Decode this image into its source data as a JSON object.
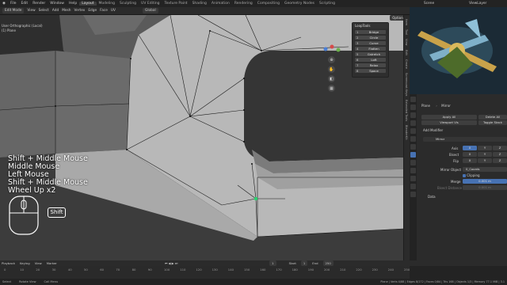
{
  "top_menu": {
    "items": [
      "File",
      "Edit",
      "Render",
      "Window",
      "Help"
    ],
    "workspaces": [
      "Layout",
      "Modeling",
      "Sculpting",
      "UV Editing",
      "Texture Paint",
      "Shading",
      "Animation",
      "Rendering",
      "Compositing",
      "Geometry Nodes",
      "Scripting"
    ],
    "active_workspace": "Layout",
    "scene": "Scene",
    "view_layer": "ViewLayer"
  },
  "viewport_header": {
    "mode": "Edit Mode",
    "menus": [
      "View",
      "Select",
      "Add",
      "Mesh",
      "Vertex",
      "Edge",
      "Face",
      "UV"
    ],
    "orientation": "Global",
    "options_label": "Options"
  },
  "viewport": {
    "view_label": "User Orthographic (Local)",
    "object_label": "(1) Plane"
  },
  "looptools": {
    "title": "LoopTools",
    "items": [
      {
        "n": "1",
        "label": "Bridge"
      },
      {
        "n": "2",
        "label": "Circle"
      },
      {
        "n": "3",
        "label": "Curve"
      },
      {
        "n": "4",
        "label": "Flatten"
      },
      {
        "n": "5",
        "label": "Gstretch"
      },
      {
        "n": "6",
        "label": "Loft"
      },
      {
        "n": "7",
        "label": "Relax"
      },
      {
        "n": "8",
        "label": "Space"
      }
    ]
  },
  "key_overlay": {
    "lines": [
      "Shift + Middle Mouse",
      "Middle Mouse",
      "Left Mouse",
      "Shift + Middle Mouse",
      "Wheel Up x2"
    ],
    "modifier_key": "Shift"
  },
  "right_strip_tabs": [
    "Item",
    "Tool",
    "View",
    "Edit",
    "Create",
    "Screencast Keys",
    "Extended Tools",
    "BlenderKit"
  ],
  "properties": {
    "object": "Plane",
    "modifier_breadcrumb": "Mirror",
    "apply_label": "Apply All",
    "delete_label": "Delete All",
    "viewport_vis": "Viewport Vis",
    "toggle_stack": "Toggle Stack",
    "add_modifier": "Add Modifier",
    "modifier_name": "Mirror",
    "axis_label": "Axis",
    "bisect_label": "Bisect",
    "flip_label": "Flip",
    "axis_values": [
      "X",
      "Y",
      "Z"
    ],
    "mirror_object_label": "Mirror Object",
    "mirror_object": "0_Coords",
    "clipping_label": "Clipping",
    "merge_label": "Merge",
    "merge_value": "0.001 m",
    "bisect_distance_label": "Bisect Distance",
    "bisect_distance_value": "0.001 m",
    "data_label": "Data"
  },
  "timeline": {
    "menus": [
      "Playback",
      "Keying",
      "View",
      "Marker"
    ],
    "current_frame": "1",
    "start_label": "Start",
    "start": "1",
    "end_label": "End",
    "end": "250",
    "ticks": [
      "0",
      "10",
      "20",
      "30",
      "40",
      "50",
      "60",
      "70",
      "80",
      "90",
      "100",
      "110",
      "120",
      "130",
      "140",
      "150",
      "160",
      "170",
      "180",
      "190",
      "200",
      "210",
      "220",
      "230",
      "240",
      "250"
    ]
  },
  "status_bar": {
    "left": [
      "Select",
      "Rotate View",
      "Call Menu"
    ],
    "right": "Plane | Verts 4/88 | Edges 8/172 | Faces 0/84 | Tris 168 | Objects 1/3 | Memory 77.1 MiB | 3.1"
  },
  "colors": {
    "active_vertex": "#29d46f",
    "accent_blue": "#4772b3"
  }
}
